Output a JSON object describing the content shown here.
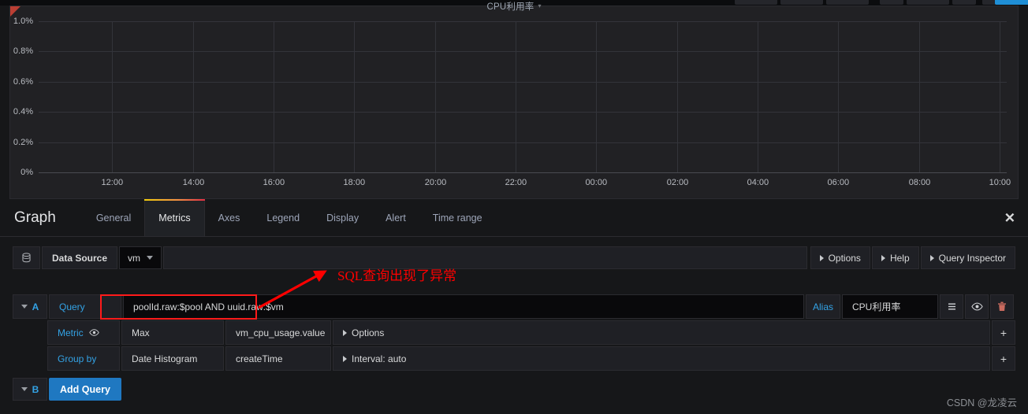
{
  "top_toolbar": {
    "buttons": [
      "",
      "",
      "",
      "",
      "",
      "",
      "",
      ""
    ]
  },
  "panel": {
    "title": "CPU利用率",
    "caret": "▾",
    "error_marker": "panel-error-corner"
  },
  "chart_data": {
    "type": "line",
    "title": "CPU利用率",
    "xlabel": "",
    "ylabel": "",
    "ylim": [
      0,
      1.0
    ],
    "grid": true,
    "legend": "none",
    "y_ticks": [
      "0%",
      "0.2%",
      "0.4%",
      "0.6%",
      "0.8%",
      "1.0%"
    ],
    "y_values": [
      0,
      0.2,
      0.4,
      0.6,
      0.8,
      1.0
    ],
    "x_ticks": [
      "12:00",
      "14:00",
      "16:00",
      "18:00",
      "20:00",
      "22:00",
      "00:00",
      "02:00",
      "04:00",
      "06:00",
      "08:00",
      "10:00"
    ],
    "series": [
      {
        "name": "CPU利用率",
        "values": []
      }
    ],
    "note": "no data rendered — empty plot area"
  },
  "editor": {
    "title": "Graph",
    "tabs": [
      {
        "label": "General",
        "active": false
      },
      {
        "label": "Metrics",
        "active": true
      },
      {
        "label": "Axes",
        "active": false
      },
      {
        "label": "Legend",
        "active": false
      },
      {
        "label": "Display",
        "active": false
      },
      {
        "label": "Alert",
        "active": false
      },
      {
        "label": "Time range",
        "active": false
      }
    ],
    "close_label": "✕"
  },
  "datasource_row": {
    "icon": "database-icon",
    "label": "Data Source",
    "selected": "vm",
    "right_buttons": [
      {
        "label": "Options",
        "icon": "caret-right-icon"
      },
      {
        "label": "Help",
        "icon": "caret-right-icon"
      },
      {
        "label": "Query Inspector",
        "icon": "caret-right-icon"
      }
    ]
  },
  "queries": [
    {
      "ref": "A",
      "collapse_icon": "caret-down-icon",
      "query_label": "Query",
      "query_value": "poolId.raw:$pool AND uuid.raw:$vm",
      "query_placeholder": "",
      "alias_label": "Alias",
      "alias_value": "CPU利用率",
      "alias_placeholder": "",
      "actions": [
        {
          "name": "query-menu-icon",
          "glyph": "☰"
        },
        {
          "name": "toggle-visibility-icon",
          "glyph": "eye"
        },
        {
          "name": "delete-query-icon",
          "glyph": "trash"
        }
      ],
      "rows": [
        {
          "label": "Metric",
          "label_icon": "eye-icon",
          "agg": "Max",
          "field": "vm_cpu_usage.value",
          "options": "Options",
          "options_icon": "caret-right-icon",
          "add": "+"
        },
        {
          "label": "Group by",
          "label_icon": "",
          "agg": "Date Histogram",
          "field": "createTime",
          "options": "Interval: auto",
          "options_icon": "caret-right-icon",
          "add": "+"
        }
      ]
    }
  ],
  "add_query_row": {
    "ref": "B",
    "collapse_icon": "caret-down-icon",
    "button_label": "Add Query"
  },
  "annotation": {
    "text": "SQL查询出现了异常",
    "color": "#ff0000",
    "arrow": "red-arrow"
  },
  "watermark": "CSDN @龙凌云",
  "colors": {
    "accent_blue": "#33a2e5",
    "button_blue": "#1f78c1",
    "tab_gradient_start": "#f2cc0c",
    "tab_gradient_mid": "#f28f43",
    "tab_gradient_end": "#e02f44",
    "panel_bg": "#212124",
    "page_bg": "#161719",
    "annotation_red": "#ff0000"
  }
}
